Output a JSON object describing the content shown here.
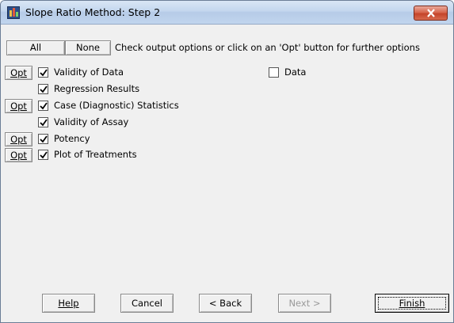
{
  "window": {
    "title": "Slope Ratio Method: Step 2"
  },
  "toolbar": {
    "all_label": "All",
    "none_label": "None",
    "instruction": "Check output options or click on an 'Opt' button for further options"
  },
  "options": [
    {
      "label": "Validity of Data",
      "checked": true,
      "has_opt": true,
      "opt_label": "Opt"
    },
    {
      "label": "Regression Results",
      "checked": true,
      "has_opt": false
    },
    {
      "label": "Case (Diagnostic) Statistics",
      "checked": true,
      "has_opt": true,
      "opt_label": "Opt"
    },
    {
      "label": "Validity of Assay",
      "checked": true,
      "has_opt": false
    },
    {
      "label": "Potency",
      "checked": true,
      "has_opt": true,
      "opt_label": "Opt"
    },
    {
      "label": "Plot of Treatments",
      "checked": true,
      "has_opt": true,
      "opt_label": "Opt"
    }
  ],
  "data_option": {
    "label": "Data",
    "checked": false
  },
  "footer": {
    "help_label": "Help",
    "cancel_label": "Cancel",
    "back_label": "< Back",
    "next_label": "Next >",
    "finish_label": "Finish",
    "next_enabled": false
  },
  "colors": {
    "close_button": "#c4442a",
    "dialog_bg": "#f0f0f0"
  }
}
